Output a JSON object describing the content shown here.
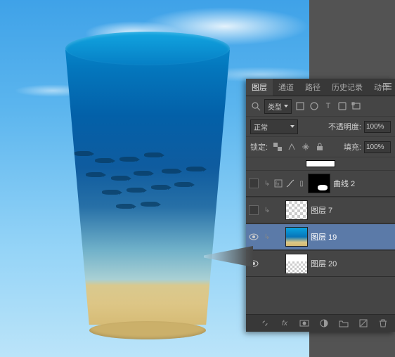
{
  "tabs": {
    "layers": "图层",
    "channels": "通道",
    "paths": "路径",
    "history": "历史记录",
    "actions": "动作"
  },
  "filter": {
    "label": "类型"
  },
  "blend": {
    "mode": "正常",
    "opacity_label": "不透明度:",
    "opacity_value": "100%"
  },
  "lock": {
    "label": "锁定:",
    "fill_label": "填充:",
    "fill_value": "100%"
  },
  "layers": {
    "curves2": "曲线 2",
    "layer7": "图层 7",
    "layer19": "图层 19",
    "layer20": "图层 20"
  },
  "footer": {
    "linked_style": "fx"
  }
}
